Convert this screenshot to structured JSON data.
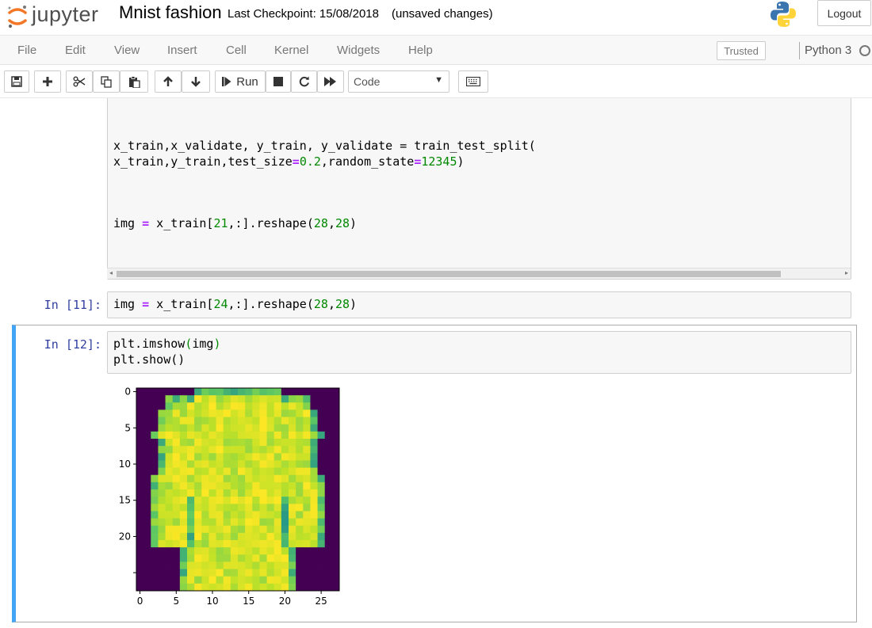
{
  "header": {
    "logo_text": "jupyter",
    "notebook_title": "Mnist fashion",
    "checkpoint": "Last Checkpoint: 15/08/2018",
    "save_status": "(unsaved changes)",
    "logout_label": "Logout"
  },
  "menubar": {
    "items": [
      "File",
      "Edit",
      "View",
      "Insert",
      "Cell",
      "Kernel",
      "Widgets",
      "Help"
    ],
    "trusted_label": "Trusted",
    "kernel_name": "Python 3"
  },
  "toolbar": {
    "run_label": "Run",
    "cell_type": "Code"
  },
  "cells": [
    {
      "prompt": "",
      "lines": [
        "x_train,x_validate, y_train, y_validate = train_test_split(",
        "x_train,y_train,test_size=0.2,random_state=12345)",
        "img = x_train[21,:].reshape(28,28)"
      ]
    },
    {
      "prompt": "In [11]:",
      "lines": [
        "img = x_train[24,:].reshape(28,28)"
      ]
    },
    {
      "prompt": "In [12]:",
      "lines": [
        "plt.imshow(img)",
        "plt.show()"
      ]
    }
  ],
  "chart_data": {
    "type": "heatmap",
    "title": "",
    "xlabel": "",
    "ylabel": "",
    "xlim": [
      -0.5,
      27.5
    ],
    "ylim": [
      27.5,
      -0.5
    ],
    "x_ticks": [
      0,
      5,
      10,
      15,
      20,
      25
    ],
    "y_ticks": [
      0,
      5,
      10,
      15,
      20,
      25
    ],
    "y_tick_labels": [
      "0",
      "5",
      "10",
      "15",
      "20",
      ""
    ],
    "colormap": "viridis",
    "grid": false,
    "description_rows": 28,
    "description_cols": 28
  },
  "colors": {
    "prompt_in": "#303f9f",
    "selected_border": "#42a5f5",
    "code_bg": "#f7f7f7",
    "operator": "#aa22ff",
    "number": "#008800"
  }
}
